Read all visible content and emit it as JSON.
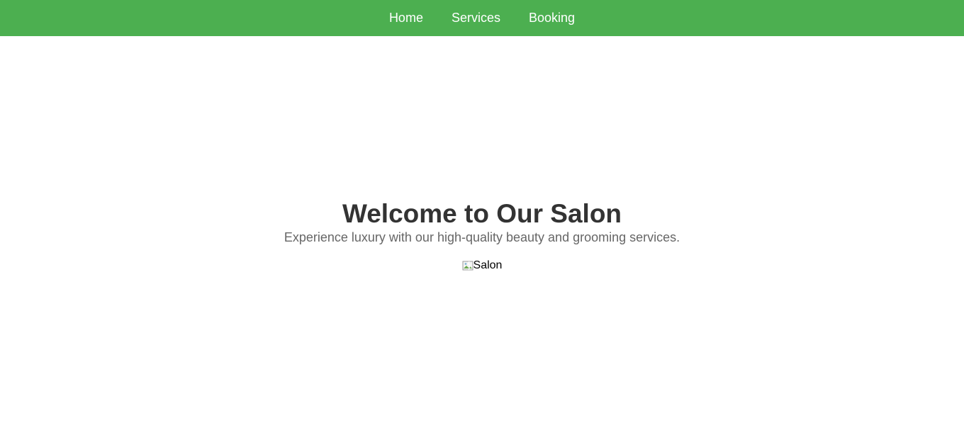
{
  "nav": {
    "items": [
      {
        "label": "Home"
      },
      {
        "label": "Services"
      },
      {
        "label": "Booking"
      }
    ],
    "background_color": "#4caf50"
  },
  "hero": {
    "title": "Welcome to Our Salon",
    "subtitle": "Experience luxury with our high-quality beauty and grooming services.",
    "image_alt": "Salon",
    "image_icon": "broken-image-icon"
  }
}
